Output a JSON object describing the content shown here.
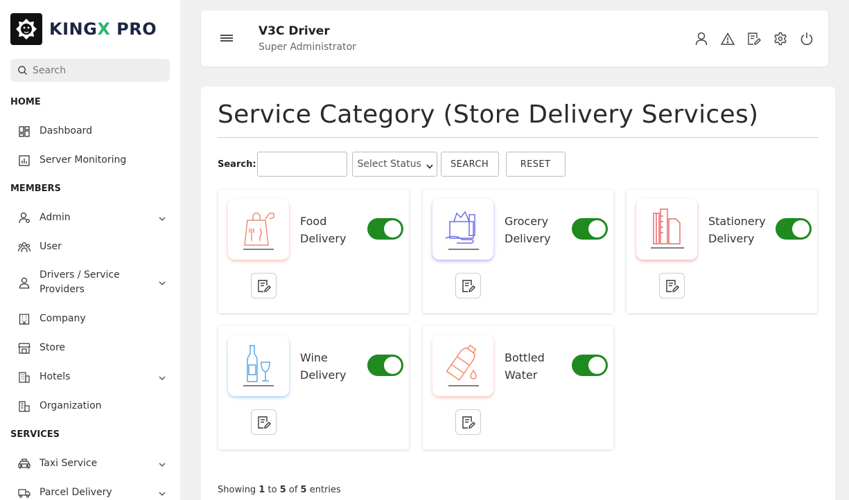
{
  "brand": {
    "name_a": "KING",
    "name_x": "X",
    "name_b": " PRO"
  },
  "sidebar": {
    "search_placeholder": "Search",
    "sections": {
      "home": "HOME",
      "members": "MEMBERS",
      "services": "SERVICES"
    },
    "items": {
      "dashboard": "Dashboard",
      "server_monitoring": "Server Monitoring",
      "admin": "Admin",
      "user": "User",
      "drivers_line1": "Drivers / Service",
      "drivers_line2": "Providers",
      "company": "Company",
      "store": "Store",
      "hotels": "Hotels",
      "organization": "Organization",
      "taxi_service": "Taxi Service",
      "parcel_delivery": "Parcel Delivery"
    }
  },
  "header": {
    "title": "V3C Driver",
    "subtitle": "Super Administrator"
  },
  "main": {
    "title": "Service Category (Store Delivery Services)",
    "filter": {
      "search_label": "Search:",
      "status_placeholder": "Select Status",
      "search_button": "SEARCH",
      "reset_button": "RESET"
    },
    "cards": [
      {
        "line1": "Food",
        "line2": "Delivery",
        "enabled": true,
        "icon": "food-bag-icon",
        "color": "#f28b6c"
      },
      {
        "line1": "Grocery",
        "line2": "Delivery",
        "enabled": true,
        "icon": "grocery-basket-icon",
        "color": "#6b6ee8"
      },
      {
        "line1": "Stationery",
        "line2": "Delivery",
        "enabled": true,
        "icon": "stationery-icon",
        "color": "#e86a6a"
      },
      {
        "line1": "Wine",
        "line2": "Delivery",
        "enabled": true,
        "icon": "wine-bottle-icon",
        "color": "#5aa6e8"
      },
      {
        "line1": "Bottled",
        "line2": "Water",
        "enabled": true,
        "icon": "water-bottle-icon",
        "color": "#f28b6c"
      }
    ],
    "footer": {
      "showing": "Showing ",
      "from": "1",
      "to_word": " to ",
      "to": "5",
      "of_word": " of ",
      "total": "5",
      "entries_word": " entries"
    }
  },
  "colors": {
    "toggle_on": "#1f8a1f",
    "brand_dark": "#1d2543",
    "brand_accent": "#2bb673"
  }
}
